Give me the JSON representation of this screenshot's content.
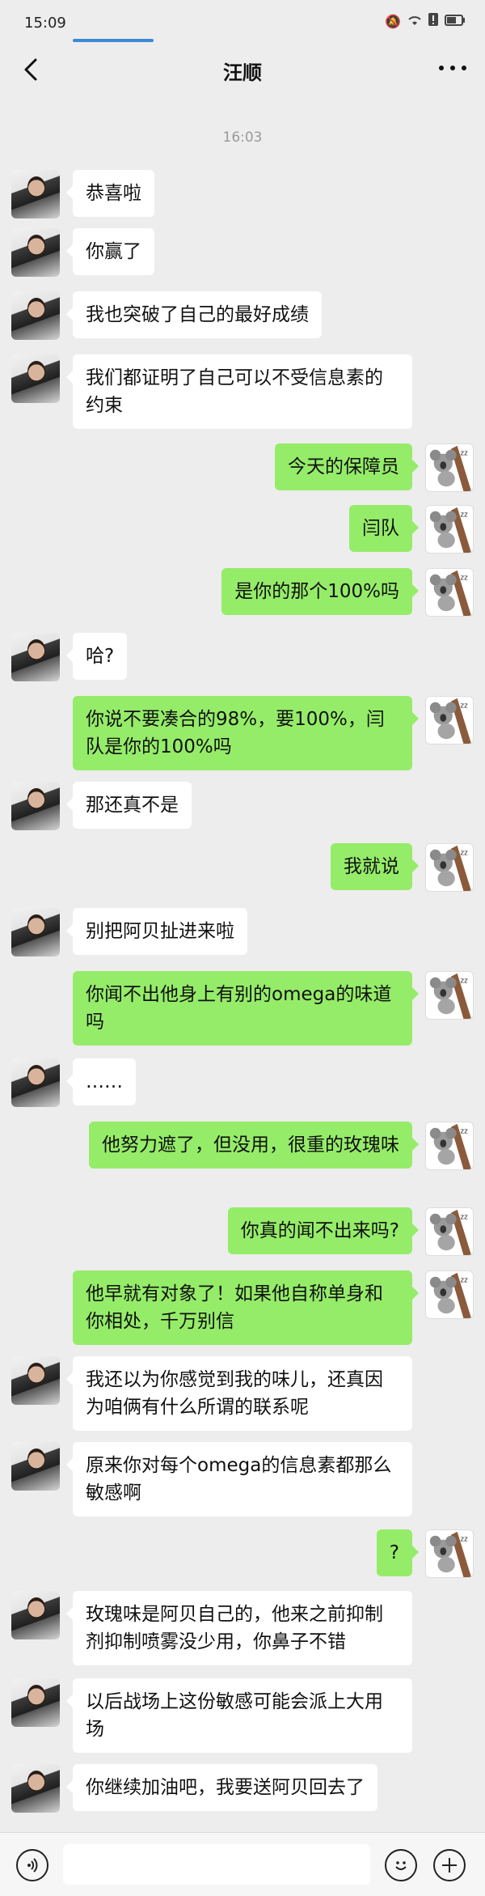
{
  "status_bar": {
    "time": "15:09",
    "icons": [
      "mute-bell-icon",
      "wifi-icon",
      "alert-icon",
      "battery-icon"
    ]
  },
  "nav": {
    "back_icon": "chevron-left-icon",
    "title": "汪顺",
    "more_icon": "more-dots-icon"
  },
  "chat": {
    "time_divider": "16:03",
    "messages": [
      {
        "side": "left",
        "text": "恭喜啦"
      },
      {
        "side": "left",
        "text": "你赢了"
      },
      {
        "side": "left",
        "text": "我也突破了自己的最好成绩"
      },
      {
        "side": "left",
        "text": "我们都证明了自己可以不受信息素的约束"
      },
      {
        "side": "right",
        "text": "今天的保障员"
      },
      {
        "side": "right",
        "text": "闫队"
      },
      {
        "side": "right",
        "text": "是你的那个100%吗"
      },
      {
        "side": "left",
        "text": "哈?"
      },
      {
        "side": "right",
        "text": "你说不要凑合的98%，要100%，闫队是你的100%吗"
      },
      {
        "side": "left",
        "text": "那还真不是"
      },
      {
        "side": "right",
        "text": "我就说"
      },
      {
        "side": "left",
        "text": "别把阿贝扯进来啦"
      },
      {
        "side": "right",
        "text": "你闻不出他身上有别的omega的味道吗"
      },
      {
        "side": "left",
        "text": "……"
      },
      {
        "side": "right",
        "text": "他努力遮了，但没用，很重的玫瑰味"
      },
      {
        "side": "right",
        "text": "你真的闻不出来吗?"
      },
      {
        "side": "right",
        "text": "他早就有对象了！如果他自称单身和你相处，千万别信"
      },
      {
        "side": "left",
        "text": "我还以为你感觉到我的味儿，还真因为咱俩有什么所谓的联系呢"
      },
      {
        "side": "left",
        "text": "原来你对每个omega的信息素都那么敏感啊"
      },
      {
        "side": "right",
        "text": "?"
      },
      {
        "side": "left",
        "text": "玫瑰味是阿贝自己的，他来之前抑制剂抑制喷雾没少用，你鼻子不错"
      },
      {
        "side": "left",
        "text": "以后战场上这份敏感可能会派上大用场"
      },
      {
        "side": "left",
        "text": "你继续加油吧，我要送阿贝回去了"
      }
    ]
  },
  "input_bar": {
    "voice_icon": "voice-icon",
    "emoji_icon": "emoji-icon",
    "plus_icon": "plus-icon"
  },
  "colors": {
    "background": "#ededed",
    "sent_bubble": "#95ec69",
    "received_bubble": "#ffffff"
  }
}
